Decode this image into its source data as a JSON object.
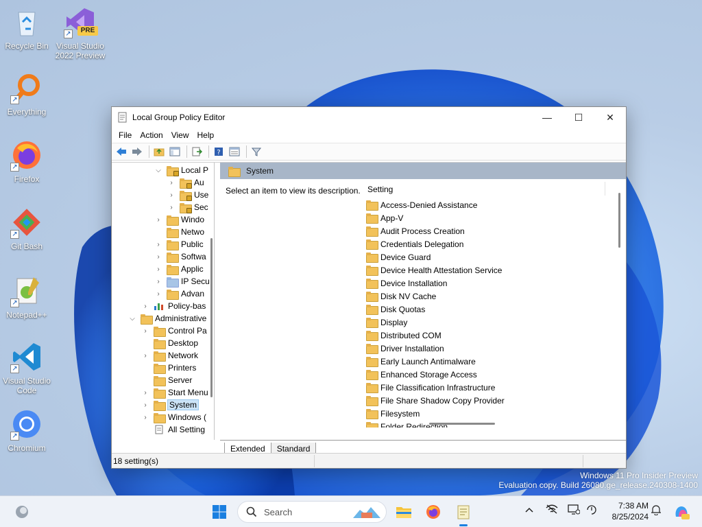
{
  "desktop": {
    "icons": [
      {
        "label": "Recycle Bin"
      },
      {
        "label": "Visual Studio 2022 Preview",
        "badge": "PRE"
      },
      {
        "label": "Everything"
      },
      {
        "label": "Firefox"
      },
      {
        "label": "Git Bash"
      },
      {
        "label": "Notepad++"
      },
      {
        "label": "Visual Studio Code"
      },
      {
        "label": "Chromium"
      }
    ],
    "watermark": {
      "line1": "Windows 11 Pro Insider Preview",
      "line2": "Evaluation copy. Build 26080.ge_release.240308-1400"
    }
  },
  "window": {
    "title": "Local Group Policy Editor",
    "controls": {
      "minimize": "—",
      "maximize": "☐",
      "close": "✕"
    },
    "menu": [
      "File",
      "Action",
      "View",
      "Help"
    ],
    "tree": [
      {
        "label": "Local P",
        "expander": "⌵",
        "lock": true
      },
      {
        "label": "Au",
        "expander": "›",
        "lock": true
      },
      {
        "label": "Use",
        "expander": "›",
        "lock": true
      },
      {
        "label": "Sec",
        "expander": "›",
        "lock": true
      },
      {
        "label": "Windo",
        "expander": "›"
      },
      {
        "label": "Netwo",
        "expander": ""
      },
      {
        "label": "Public",
        "expander": "›"
      },
      {
        "label": "Softwa",
        "expander": "›"
      },
      {
        "label": "Applic",
        "expander": "›"
      },
      {
        "label": "IP Secu",
        "expander": "›",
        "icon": "ip-security-icon"
      },
      {
        "label": "Advan",
        "expander": "›"
      },
      {
        "label": "Policy-bas",
        "expander": "›",
        "icon": "chart-icon"
      },
      {
        "label": "Administrative",
        "expander": "⌵"
      },
      {
        "label": "Control Pa",
        "expander": "›"
      },
      {
        "label": "Desktop",
        "expander": ""
      },
      {
        "label": "Network",
        "expander": "›"
      },
      {
        "label": "Printers",
        "expander": ""
      },
      {
        "label": "Server",
        "expander": ""
      },
      {
        "label": "Start Menu",
        "expander": "›"
      },
      {
        "label": "System",
        "expander": "›",
        "selected": true
      },
      {
        "label": "Windows (",
        "expander": "›"
      },
      {
        "label": "All Setting",
        "expander": "",
        "icon": "settings-page-icon"
      }
    ],
    "right_pane": {
      "header": "System",
      "description": "Select an item to view its description.",
      "column": "Setting",
      "items": [
        "Access-Denied Assistance",
        "App-V",
        "Audit Process Creation",
        "Credentials Delegation",
        "Device Guard",
        "Device Health Attestation Service",
        "Device Installation",
        "Disk NV Cache",
        "Disk Quotas",
        "Display",
        "Distributed COM",
        "Driver Installation",
        "Early Launch Antimalware",
        "Enhanced Storage Access",
        "File Classification Infrastructure",
        "File Share Shadow Copy Provider",
        "Filesystem",
        "Folder Redirection"
      ]
    },
    "tabs": [
      "Extended",
      "Standard"
    ],
    "status": "18 setting(s)"
  },
  "taskbar": {
    "search_placeholder": "Search",
    "clock_time": "7:38 AM",
    "clock_date": "8/25/2024",
    "apps": [
      "start-icon",
      "search",
      "file-explorer-icon",
      "firefox-icon",
      "notepad-icon"
    ],
    "tray": [
      "chevron-up-icon",
      "network-off-icon",
      "display-icon",
      "battery-icon"
    ]
  }
}
